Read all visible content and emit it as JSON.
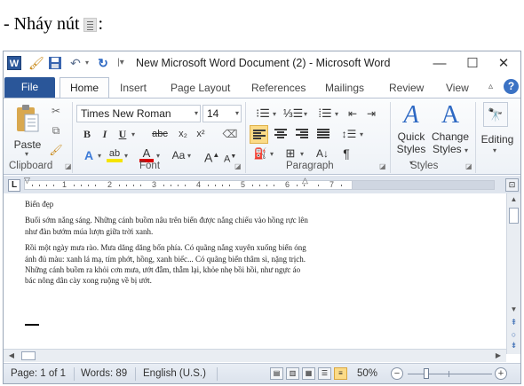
{
  "instruction": {
    "text_before": "- Nháy nút ",
    "text_after": ":",
    "icon": "justify-align-icon"
  },
  "window": {
    "title": "New Microsoft Word Document (2)  -  Microsoft Word",
    "qat_icons": [
      "word-logo-icon",
      "brush-icon",
      "save-icon",
      "undo-icon",
      "redo-icon",
      "customize-qat-icon"
    ],
    "controls": [
      "minimize-icon",
      "maximize-icon",
      "close-icon"
    ]
  },
  "tabs": {
    "file": "File",
    "items": [
      "Home",
      "Insert",
      "Page Layout",
      "References",
      "Mailings",
      "Review",
      "View"
    ],
    "active": "Home",
    "help": "?"
  },
  "ribbon": {
    "clipboard": {
      "paste": "Paste",
      "label": "Clipboard"
    },
    "font": {
      "name": "Times New Roman",
      "size": "14",
      "bold": "B",
      "italic": "I",
      "underline": "U",
      "strikethrough": "abc",
      "subscript": "x₂",
      "superscript": "x²",
      "change_case": "Aa",
      "grow": "A",
      "shrink": "A",
      "label": "Font",
      "highlight_color": "#f5e400",
      "font_color": "#d80000"
    },
    "paragraph": {
      "label": "Paragraph",
      "active_button": "align-left"
    },
    "styles": {
      "quick": "Quick",
      "quick2": "Styles",
      "change": "Change",
      "change2": "Styles",
      "label": "Styles"
    },
    "editing": {
      "label": "Editing"
    }
  },
  "ruler": {
    "numbers": [
      "1",
      "2",
      "3",
      "4",
      "5",
      "6",
      "7"
    ],
    "tab_selector": "L"
  },
  "document": {
    "title": "Biển đẹp",
    "paragraphs": [
      "Buổi sớm nắng sáng. Những cánh buồm nâu trên biển được nắng chiếu vào hồng rực lên như đàn bướm múa lượn giữa trời xanh.",
      "Rồi một ngày mưa rào. Mưa dăng dăng bốn phía. Có quãng nắng xuyên xuống biển óng ánh đủ màu: xanh lá mạ, tím phớt, hồng, xanh biếc... Có quãng biển thâm sì, nặng trịch. Những cánh buồm ra khỏi cơn mưa, ướt đẫm, thẫm lại, khỏe nhẹ bồi hồi, như ngực áo bác nông dân cày xong ruộng về bị ướt."
    ]
  },
  "statusbar": {
    "page": "Page: 1 of 1",
    "words": "Words: 89",
    "language": "English (U.S.)",
    "zoom": "50%",
    "zoom_value": 0.5,
    "zoom_minus": "−",
    "zoom_plus": "+"
  }
}
